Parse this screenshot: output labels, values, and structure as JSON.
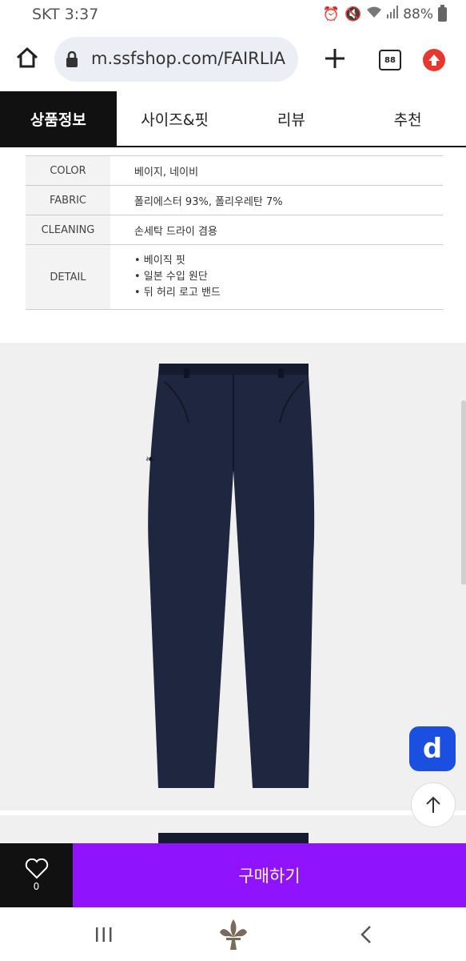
{
  "status": {
    "carrier_time": "SKT 3:37",
    "battery": "88%"
  },
  "browser": {
    "url": "m.ssfshop.com/FAIRLIA",
    "tab_count": "88"
  },
  "product_tabs": [
    {
      "label": "상품정보",
      "active": true
    },
    {
      "label": "사이즈&핏",
      "active": false
    },
    {
      "label": "리뷰",
      "active": false
    },
    {
      "label": "추천",
      "active": false
    }
  ],
  "spec": {
    "color": {
      "key": "COLOR",
      "value": "베이지, 네이비"
    },
    "fabric": {
      "key": "FABRIC",
      "value": "폴리에스터 93%,  폴리우레탄 7%"
    },
    "cleaning": {
      "key": "CLEANING",
      "value": "손세탁 드라이 겸용"
    },
    "detail": {
      "key": "DETAIL",
      "lines": [
        "• 베이직 핏",
        "• 일본 수입 원단",
        "• 뒤 허리 로고 밴드"
      ]
    }
  },
  "floating": {
    "d_label": "d"
  },
  "bottom_bar": {
    "wish_count": "0",
    "buy_label": "구매하기"
  },
  "colors": {
    "purchase": "#9013fe",
    "tab_active": "#111111",
    "pants": "#1e2640",
    "d_button": "#1a4fe0"
  }
}
